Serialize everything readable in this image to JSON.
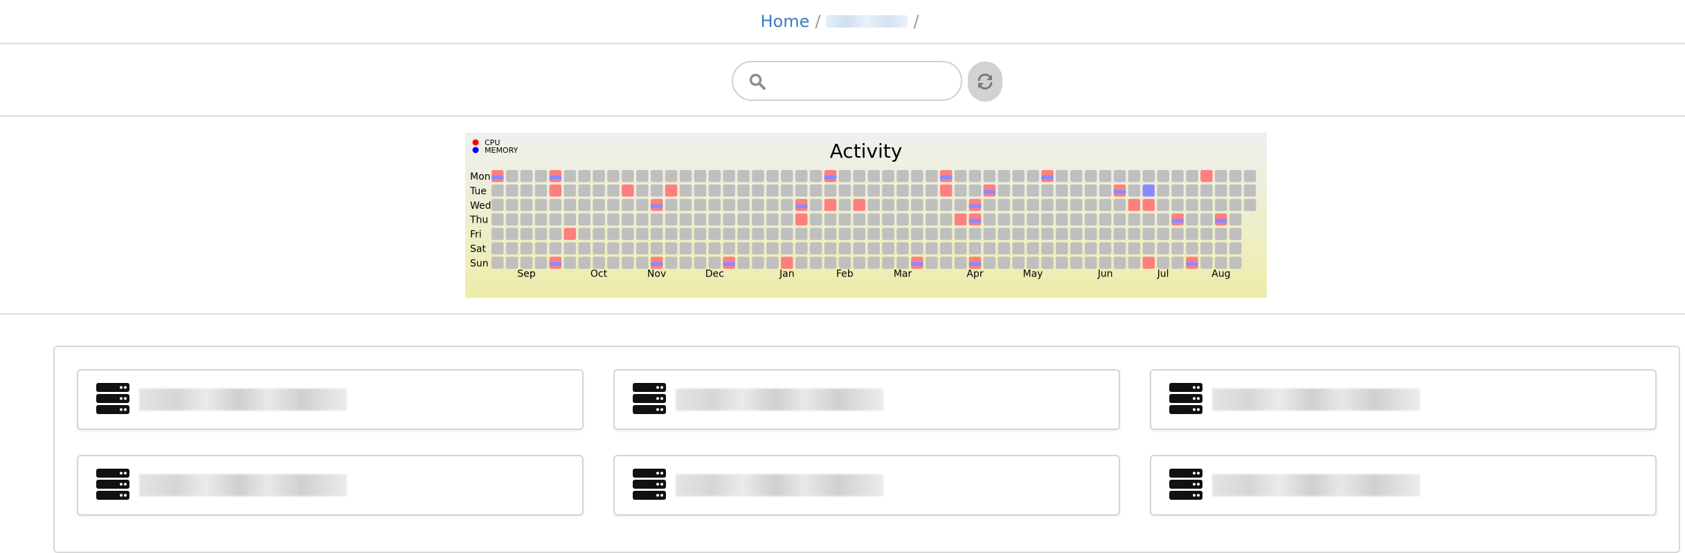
{
  "breadcrumb": {
    "home": "Home",
    "separator": "/",
    "current": ""
  },
  "search": {
    "placeholder": "",
    "value": "",
    "icon": "search-icon",
    "refresh_icon": "refresh-icon"
  },
  "chart_data": {
    "type": "heatmap",
    "title": "Activity",
    "legend": [
      {
        "name": "CPU",
        "color": "#ff0000"
      },
      {
        "name": "MEMORY",
        "color": "#0000ff"
      }
    ],
    "legend_position": "top-left",
    "rows": [
      "Mon",
      "Tue",
      "Wed",
      "Thu",
      "Fri",
      "Sat",
      "Sun"
    ],
    "months": [
      {
        "label": "Sep",
        "week": 2
      },
      {
        "label": "Oct",
        "week": 7
      },
      {
        "label": "Nov",
        "week": 11
      },
      {
        "label": "Dec",
        "week": 15
      },
      {
        "label": "Jan",
        "week": 20
      },
      {
        "label": "Feb",
        "week": 24
      },
      {
        "label": "Mar",
        "week": 28
      },
      {
        "label": "Apr",
        "week": 33
      },
      {
        "label": "May",
        "week": 37
      },
      {
        "label": "Jun",
        "week": 42
      },
      {
        "label": "Jul",
        "week": 46
      },
      {
        "label": "Aug",
        "week": 50
      }
    ],
    "weeks": 53,
    "last_week_days": 3,
    "colors": {
      "empty": "#bfbfbf",
      "cpu": "#ff7f7f",
      "memory": "#8a8aff"
    },
    "cells": [
      {
        "week": 0,
        "day": 0,
        "cpu": 1,
        "memory": 1
      },
      {
        "week": 4,
        "day": 0,
        "cpu": 1,
        "memory": 1
      },
      {
        "week": 23,
        "day": 0,
        "cpu": 1,
        "memory": 1
      },
      {
        "week": 31,
        "day": 0,
        "cpu": 1,
        "memory": 1
      },
      {
        "week": 38,
        "day": 0,
        "cpu": 1,
        "memory": 1
      },
      {
        "week": 49,
        "day": 0,
        "cpu": 1,
        "memory": 0
      },
      {
        "week": 4,
        "day": 1,
        "cpu": 1,
        "memory": 0
      },
      {
        "week": 9,
        "day": 1,
        "cpu": 1,
        "memory": 0
      },
      {
        "week": 12,
        "day": 1,
        "cpu": 1,
        "memory": 0
      },
      {
        "week": 31,
        "day": 1,
        "cpu": 1,
        "memory": 0
      },
      {
        "week": 34,
        "day": 1,
        "cpu": 1,
        "memory": 1
      },
      {
        "week": 43,
        "day": 1,
        "cpu": 1,
        "memory": 1
      },
      {
        "week": 45,
        "day": 1,
        "cpu": 0,
        "memory": 1
      },
      {
        "week": 11,
        "day": 2,
        "cpu": 1,
        "memory": 1
      },
      {
        "week": 21,
        "day": 2,
        "cpu": 1,
        "memory": 1
      },
      {
        "week": 23,
        "day": 2,
        "cpu": 1,
        "memory": 0
      },
      {
        "week": 25,
        "day": 2,
        "cpu": 1,
        "memory": 0
      },
      {
        "week": 33,
        "day": 2,
        "cpu": 1,
        "memory": 1
      },
      {
        "week": 44,
        "day": 2,
        "cpu": 1,
        "memory": 0
      },
      {
        "week": 45,
        "day": 2,
        "cpu": 1,
        "memory": 0
      },
      {
        "week": 21,
        "day": 3,
        "cpu": 1,
        "memory": 0
      },
      {
        "week": 32,
        "day": 3,
        "cpu": 1,
        "memory": 0
      },
      {
        "week": 33,
        "day": 3,
        "cpu": 1,
        "memory": 1
      },
      {
        "week": 47,
        "day": 3,
        "cpu": 1,
        "memory": 1
      },
      {
        "week": 50,
        "day": 3,
        "cpu": 1,
        "memory": 1
      },
      {
        "week": 5,
        "day": 4,
        "cpu": 1,
        "memory": 0
      },
      {
        "week": 4,
        "day": 6,
        "cpu": 1,
        "memory": 1
      },
      {
        "week": 11,
        "day": 6,
        "cpu": 1,
        "memory": 1
      },
      {
        "week": 16,
        "day": 6,
        "cpu": 1,
        "memory": 1
      },
      {
        "week": 20,
        "day": 6,
        "cpu": 1,
        "memory": 0
      },
      {
        "week": 29,
        "day": 6,
        "cpu": 1,
        "memory": 1
      },
      {
        "week": 33,
        "day": 6,
        "cpu": 1,
        "memory": 1
      },
      {
        "week": 45,
        "day": 6,
        "cpu": 1,
        "memory": 0
      },
      {
        "week": 48,
        "day": 6,
        "cpu": 1,
        "memory": 1
      }
    ]
  },
  "servers": [
    {
      "name": "",
      "icon": "server-icon"
    },
    {
      "name": "",
      "icon": "server-icon"
    },
    {
      "name": "",
      "icon": "server-icon"
    },
    {
      "name": "",
      "icon": "server-icon"
    },
    {
      "name": "",
      "icon": "server-icon"
    },
    {
      "name": "",
      "icon": "server-icon"
    }
  ]
}
